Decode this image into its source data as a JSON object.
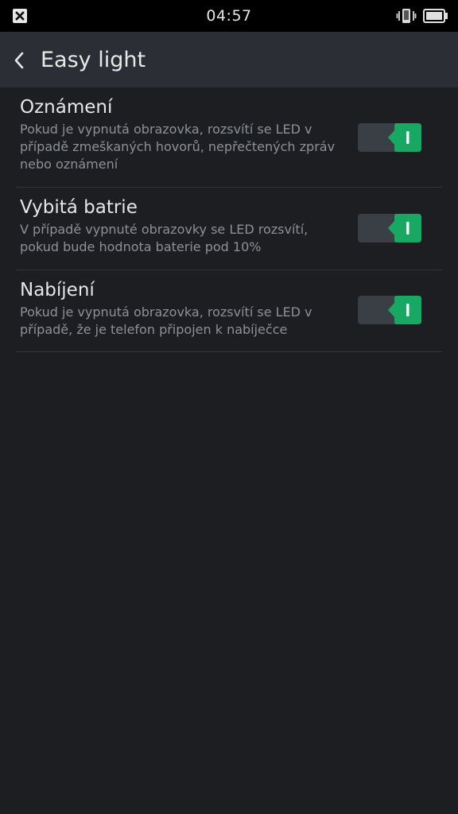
{
  "status_bar": {
    "time": "04:57",
    "icons": [
      "notification-close-icon",
      "vibrate-icon",
      "battery-icon"
    ]
  },
  "header": {
    "title": "Easy light",
    "back_icon": "chevron-left-icon"
  },
  "settings": [
    {
      "title": "Oznámení",
      "description": "Pokud je vypnutá obrazovka, rozsvítí se LED v případě zmeškaných hovorů, nepřečtených zpráv nebo oznámení",
      "enabled": true
    },
    {
      "title": "Vybitá batrie",
      "description": "V případě vypnuté obrazovky se LED rozsvítí, pokud bude hodnota baterie pod 10%",
      "enabled": true
    },
    {
      "title": "Nabíjení",
      "description": "Pokud je vypnutá obrazovka, rozsvítí se LED v případě, že je telefon připojen k nabíječce",
      "enabled": true
    }
  ],
  "colors": {
    "background": "#1c1e21",
    "header": "#2b2f35",
    "toggle_on": "#17a864",
    "toggle_track": "#3a3e45"
  }
}
